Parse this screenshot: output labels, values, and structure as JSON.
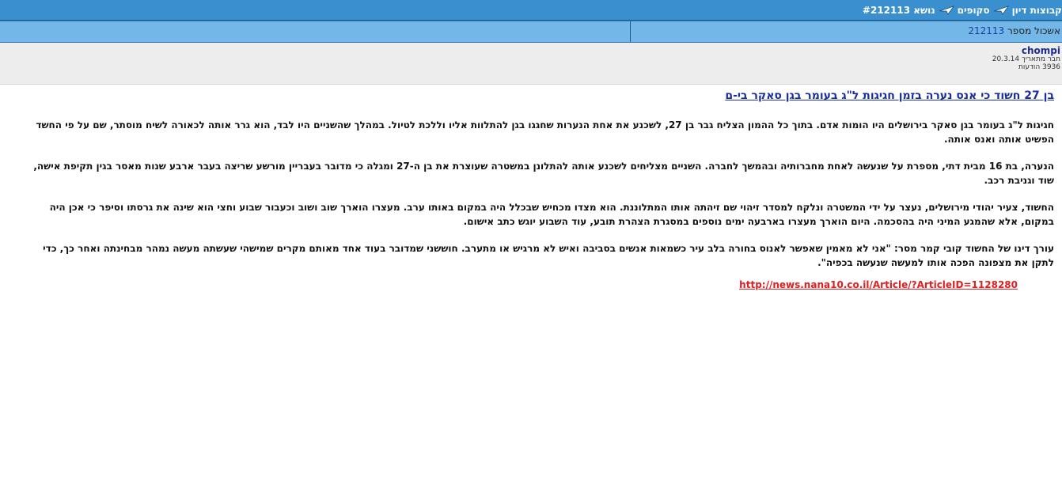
{
  "breadcrumbs": [
    {
      "label": "קבוצות דיון"
    },
    {
      "label": "סקופים"
    },
    {
      "label": "נושא #212113"
    }
  ],
  "archive": {
    "label": "אשכול מספר",
    "number": "212113"
  },
  "user": {
    "name": "chompi",
    "member_since": "חבר מתאריך 20.3.14",
    "posts": "3936 הודעות"
  },
  "post": {
    "title": "בן 27 חשוד כי אנס נערה בזמן חגיגות ל\"ג בעומר בגן סאקר בי-ם",
    "paragraphs": [
      "חגיגות ל\"ג בעומר בגן סאקר בירושלים היו הומות אדם. בתוך כל ההמון הצליח גבר בן 27, לשכנע את אחת הנערות שחגגו בגן להתלוות אליו וללכת לטיול. במהלך שהשניים היו לבד, הוא גרר אותה לכאורה לשיח מוסתר, שם על פי החשד הפשיט אותה ואנס אותה.",
      "הנערה, בת 16 מבית דתי, מספרת על שנעשה לאחת מחברותיה ובהמשך לחברה. השניים מצליחים לשכנע אותה להתלונן במשטרה שעוצרת את בן ה-27 ומגלה כי מדובר בעבריין מורשע שריצה בעבר ארבע שנות מאסר בגין תקיפת אישה, שוד וגניבת רכב.",
      "החשוד, צעיר יהודי מירושלים, נעצר על ידי המשטרה ונלקח למסדר זיהוי שם זיהתה אותו המתלוננת. הוא מצדו מכחיש שבכלל היה במקום באותו ערב. מעצרו הוארך שוב ושוב וכעבור שבוע וחצי הוא שינה את גרסתו וסיפר כי אכן היה במקום, אלא שהמגע המיני היה בהסכמה. היום הוארך מעצרו בארבעה ימים נוספים במסגרת הצהרת תובע, עוד השבוע יוגש כתב אישום.",
      "עורך דינו של החשוד קובי קמר מסר: \"אני לא מאמין שאפשר לאנוס בחורה בלב עיר כשמאות אנשים בסביבה ואיש לא מרגיש או מתערב. חוששני שמדובר בעוד אחד מאותם מקרים שמישהי שעשתה מעשה נמהר מבחינתה ואחר כך, כדי לתקן את מצפונה הפכה אותו למעשה שנעשה בכפיה\"."
    ],
    "link": "http://news.nana10.co.il/Article/?ArticleID=1128280"
  },
  "colors": {
    "topbar": "#3a8fcf",
    "header2": "#72b7e8",
    "userbox": "#ededed",
    "title": "#1a2f9e",
    "link": "#e02020"
  }
}
